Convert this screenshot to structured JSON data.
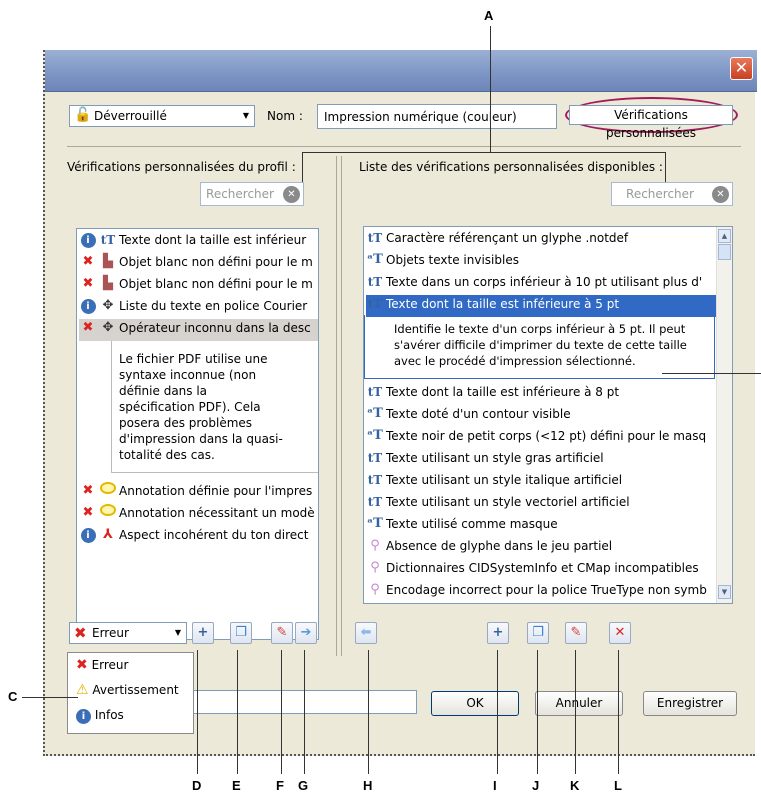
{
  "callouts": {
    "A": "A",
    "C": "C",
    "D": "D",
    "E": "E",
    "F": "F",
    "G": "G",
    "H": "H",
    "I": "I",
    "J": "J",
    "K": "K",
    "L": "L"
  },
  "header": {
    "lock_state": "Déverrouillé",
    "name_label": "Nom :",
    "name_value": "Impression numérique (couleur)",
    "custom_checks_button": "Vérifications personnalisées"
  },
  "left_panel": {
    "title": "Vérifications personnalisées du profil :",
    "search_placeholder": "Rechercher",
    "items": [
      {
        "icon": "info-icon",
        "type": "text-icon",
        "label": "Texte dont la taille est inférieur"
      },
      {
        "icon": "error-icon",
        "type": "object-icon",
        "label": "Objet blanc non défini pour le m"
      },
      {
        "icon": "error-icon",
        "type": "object-icon",
        "label": "Objet blanc non défini pour le m"
      },
      {
        "icon": "info-icon",
        "type": "move-icon",
        "label": "Liste du texte en police Courier"
      },
      {
        "icon": "error-icon",
        "type": "move-icon",
        "label": "Opérateur inconnu dans la desc"
      }
    ],
    "description": [
      "Le fichier PDF utilise une",
      "syntaxe inconnue (non",
      "définie dans la",
      "spécification PDF). Cela",
      "posera des problèmes",
      "d'impression dans la quasi-",
      "totalité des cas."
    ],
    "items_after": [
      {
        "icon": "error-icon",
        "type": "comment-icon",
        "label": "Annotation définie pour l'impres"
      },
      {
        "icon": "error-icon",
        "type": "comment-icon",
        "label": "Annotation nécessitant un modè"
      },
      {
        "icon": "info-icon",
        "type": "pdf-icon",
        "label": "Aspect incohérent du ton direct"
      }
    ]
  },
  "right_panel": {
    "title": "Liste des vérifications personnalisées disponibles :",
    "search_placeholder": "Rechercher",
    "items": [
      "Caractère référençant un glyphe .notdef",
      "Objets texte invisibles",
      "Texte dans un corps inférieur à 10 pt utilisant plus d'",
      "Texte dont la taille est inférieure à 5 pt"
    ],
    "description": [
      "Identifie le texte d'un corps inférieur à 5 pt. Il peut",
      "s'avérer difficile d'imprimer du texte de cette taille",
      "avec le procédé d'impression sélectionné."
    ],
    "items_after": [
      "Texte dont la taille est inférieure à 8 pt",
      "Texte doté d'un contour visible",
      "Texte noir de petit corps (<12 pt) défini pour le masq",
      "Texte utilisant un style gras artificiel",
      "Texte utilisant un style italique artificiel",
      "Texte utilisant un style vectoriel artificiel",
      "Texte utilisé comme masque",
      "Absence de glyphe dans le jeu partiel",
      "Dictionnaires CIDSystemInfo et CMap incompatibles",
      "Encodage incorrect pour la police TrueType non symb"
    ]
  },
  "severity": {
    "selected": "Erreur",
    "options": [
      "Erreur",
      "Avertissement",
      "Infos"
    ]
  },
  "buttons": {
    "ok": "OK",
    "cancel": "Annuler",
    "save": "Enregistrer"
  },
  "colors": {
    "selection": "#316ac5",
    "accent_ring": "#a01c5a",
    "title_bar": "#7f97c6",
    "close": "#d9542f"
  }
}
